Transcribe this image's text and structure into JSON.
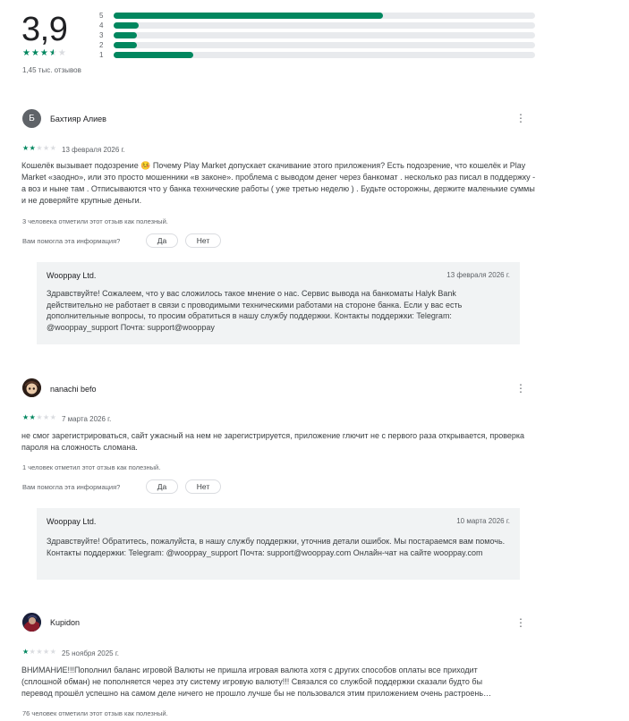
{
  "summary": {
    "rating": "3,9",
    "stars": 3.5,
    "review_count": "1,45 тыс. отзывов",
    "histogram": [
      {
        "label": "5",
        "fraction": 0.64
      },
      {
        "label": "4",
        "fraction": 0.06
      },
      {
        "label": "3",
        "fraction": 0.055
      },
      {
        "label": "2",
        "fraction": 0.055
      },
      {
        "label": "1",
        "fraction": 0.19
      }
    ]
  },
  "colors": {
    "accent": "#01875f",
    "track": "#e8eaed",
    "reply_bg": "#f1f3f4"
  },
  "reviews": [
    {
      "author": "Бахтияр Алиев",
      "avatar_letter": "Б",
      "stars": "★★☆☆☆",
      "rating": 2,
      "date": "13 февраля 2026 г.",
      "text": "Кошелёк вызывает подозрение 🤒 Почему Play Market допускает скачивание этого приложения? Есть подозрение, что кошелёк и Play Market «заодно», или это просто мошенники «в законе». проблема с выводом денег через банкомат . несколько раз писал в поддержку - а воз и ныне там . Отписываются что у банка технические работы ( уже третью неделю ) . Будьте осторожны, держите маленькие суммы и не доверяйте крупные деньги.",
      "helpful": "3 человека отметили этот отзыв как полезный.",
      "help_question": "Вам помогла эта информация?",
      "yes": "Да",
      "no": "Нет",
      "reply": {
        "name": "Wooppay Ltd.",
        "date": "13 февраля 2026 г.",
        "text": "Здравствуйте! Сожалеем, что у вас сложилось такое мнение о нас. Сервис вывода на банкоматы Halyk Bank действительно не работает в связи с проводимыми техническими работами на стороне банка. Если у вас есть дополнительные вопросы, то просим обратиться в нашу службу поддержки. Контакты поддержки: Telegram: @wooppay_support Почта: support@wooppay"
      }
    },
    {
      "author": "nanachi befo",
      "stars": "★★☆☆☆",
      "rating": 2,
      "date": "7 марта 2026 г.",
      "text": "не смог зарегистрироваться, сайт ужасный на нем не зарегистрируется, приложение глючит не с первого раза открывается, проверка пароля на сложность сломана.",
      "helpful": "1 человек отметил этот отзыв как полезный.",
      "help_question": "Вам помогла эта информация?",
      "yes": "Да",
      "no": "Нет",
      "reply": {
        "name": "Wooppay Ltd.",
        "date": "10 марта 2026 г.",
        "text": "Здравствуйте! Обратитесь, пожалуйста, в нашу службу поддержки, уточнив детали ошибок. Мы постараемся вам помочь. Контакты поддержки: Telegram: @wooppay_support Почта: support@wooppay.com Онлайн-чат на сайте wooppay.com"
      }
    },
    {
      "author": "Kupidon",
      "stars": "★☆☆☆☆",
      "rating": 1,
      "date": "25 ноября 2025 г.",
      "text_line1": "ВНИМАНИЕ!!!Пополнил баланс игровой Валюты не пришла игровая валюта хотя с других способов оплаты все приходит",
      "text_line2": "(сплошной обман) не пополняется через эту систему игровую валюту!!! Связался со службой поддержки сказали будто бы",
      "text_line3": "перевод прошёл успешно на самом деле ничего не прошло лучше бы не пользовался этим приложением очень растроень…",
      "helpful": "76 человек отметили этот отзыв как полезный."
    }
  ]
}
